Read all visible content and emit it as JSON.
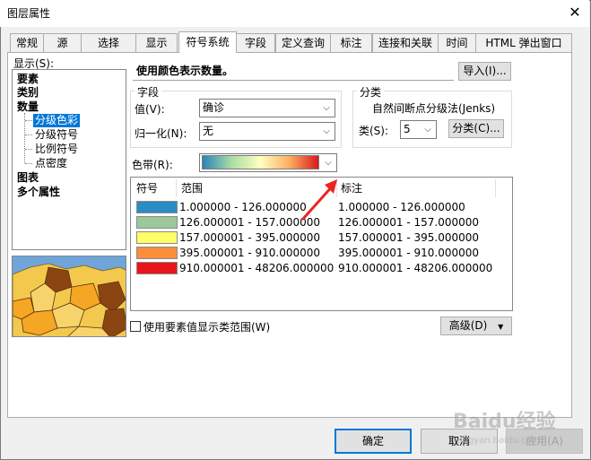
{
  "window": {
    "title": "图层属性",
    "close_glyph": "✕"
  },
  "tabs": [
    {
      "label": "常规",
      "active": false
    },
    {
      "label": "源",
      "active": false
    },
    {
      "label": "选择",
      "active": false
    },
    {
      "label": "显示",
      "active": false
    },
    {
      "label": "符号系统",
      "active": true
    },
    {
      "label": "字段",
      "active": false
    },
    {
      "label": "定义查询",
      "active": false
    },
    {
      "label": "标注",
      "active": false
    },
    {
      "label": "连接和关联",
      "active": false
    },
    {
      "label": "时间",
      "active": false
    },
    {
      "label": "HTML 弹出窗口",
      "active": false
    }
  ],
  "show_panel": {
    "label": "显示(S):",
    "items": [
      {
        "label": "要素",
        "bold": true
      },
      {
        "label": "类别",
        "bold": true
      },
      {
        "label": "数量",
        "bold": true
      },
      {
        "label": "分级色彩",
        "selected": true
      },
      {
        "label": "分级符号"
      },
      {
        "label": "比例符号"
      },
      {
        "label": "点密度"
      },
      {
        "label": "图表",
        "bold": true
      },
      {
        "label": "多个属性",
        "bold": true
      }
    ]
  },
  "description": "使用颜色表示数量。",
  "import_button": "导入(I)...",
  "field_group": {
    "title": "字段",
    "value_label": "值(V):",
    "value": "确诊",
    "normalize_label": "归一化(N):",
    "normalize_value": "无"
  },
  "classification_group": {
    "title": "分类",
    "method": "自然间断点分级法(Jenks)",
    "classes_label": "类(S):",
    "classes_value": "5",
    "classify_button": "分类(C)..."
  },
  "color_ramp_label": "色带(R):",
  "table": {
    "headers": {
      "symbol": "符号",
      "range": "范围",
      "label": "标注"
    },
    "rows": [
      {
        "color": "#2b8cc4",
        "range": "1.000000 - 126.000000",
        "label": "1.000000 - 126.000000"
      },
      {
        "color": "#9dc89a",
        "range": "126.000001 - 157.000000",
        "label": "126.000001 - 157.000000"
      },
      {
        "color": "#ffff66",
        "range": "157.000001 - 395.000000",
        "label": "157.000001 - 395.000000"
      },
      {
        "color": "#fb8d3d",
        "range": "395.000001 - 910.000000",
        "label": "395.000001 - 910.000000"
      },
      {
        "color": "#e8161c",
        "range": "910.000001 - 48206.000000",
        "label": "910.000001 - 48206.000000"
      }
    ]
  },
  "use_feature_values_label": "使用要素值显示类范围(W)",
  "advanced_button": "高级(D)",
  "footer": {
    "ok": "确定",
    "cancel": "取消",
    "apply": "应用(A)"
  },
  "watermark": {
    "brand": "Baidu经验",
    "url": "jingyan.baidu.com"
  },
  "colors": {
    "selection": "#0078d7",
    "annotation_arrow": "#e8261f"
  }
}
